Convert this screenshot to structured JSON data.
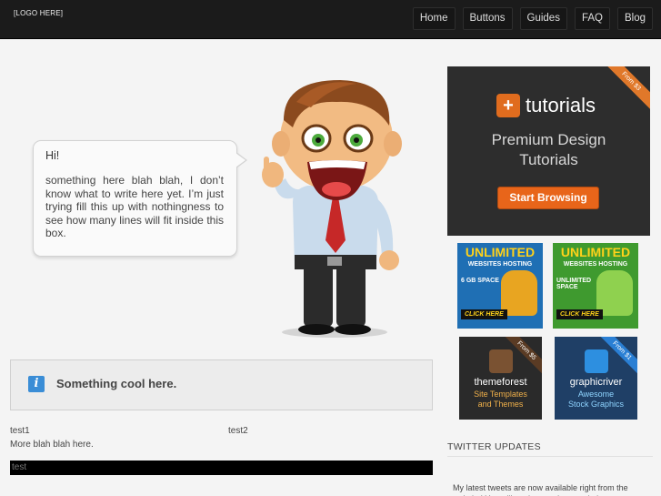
{
  "header": {
    "logo": "[LOGO HERE]",
    "nav": [
      {
        "label": "Home"
      },
      {
        "label": "Buttons"
      },
      {
        "label": "Guides"
      },
      {
        "label": "FAQ"
      },
      {
        "label": "Blog"
      }
    ]
  },
  "bubble": {
    "greeting": "Hi!",
    "message": "something here blah blah, I don’t know what to write here yet. I’m just trying fill this up with nothingness to see how many lines will fit inside this box."
  },
  "info_box": {
    "icon": "info-icon",
    "text": "Something cool here."
  },
  "columns": {
    "col1_title": "test1",
    "col1_text": "More blah blah here.",
    "col2_title": "test2"
  },
  "black_bar": {
    "text": "test"
  },
  "sidebar": {
    "main_ad": {
      "ribbon": "From $3",
      "brand": "tutorials",
      "tagline_1": "Premium Design",
      "tagline_2": "Tutorials",
      "cta": "Start Browsing",
      "accent": "#e8651a"
    },
    "hosting_ads": [
      {
        "title": "UNLIMITED",
        "subtitle": "WEBSITES HOSTING",
        "feature": "6 GB SPACE",
        "cta": "CLICK HERE"
      },
      {
        "title": "UNLIMITED",
        "subtitle": "WEBSITES HOSTING",
        "feature": "UNLIMITED SPACE",
        "cta": "CLICK HERE"
      }
    ],
    "market_ads": [
      {
        "ribbon": "From $5",
        "name": "themeforest",
        "sub_1": "Site Templates",
        "sub_2": "and Themes"
      },
      {
        "ribbon": "From $1",
        "name": "graphicriver",
        "sub_1": "Awesome",
        "sub_2": "Stock Graphics"
      }
    ],
    "twitter": {
      "title": "TWITTER UPDATES",
      "text": "My latest tweets are now available right from the website! You will not have to jump website..."
    }
  }
}
